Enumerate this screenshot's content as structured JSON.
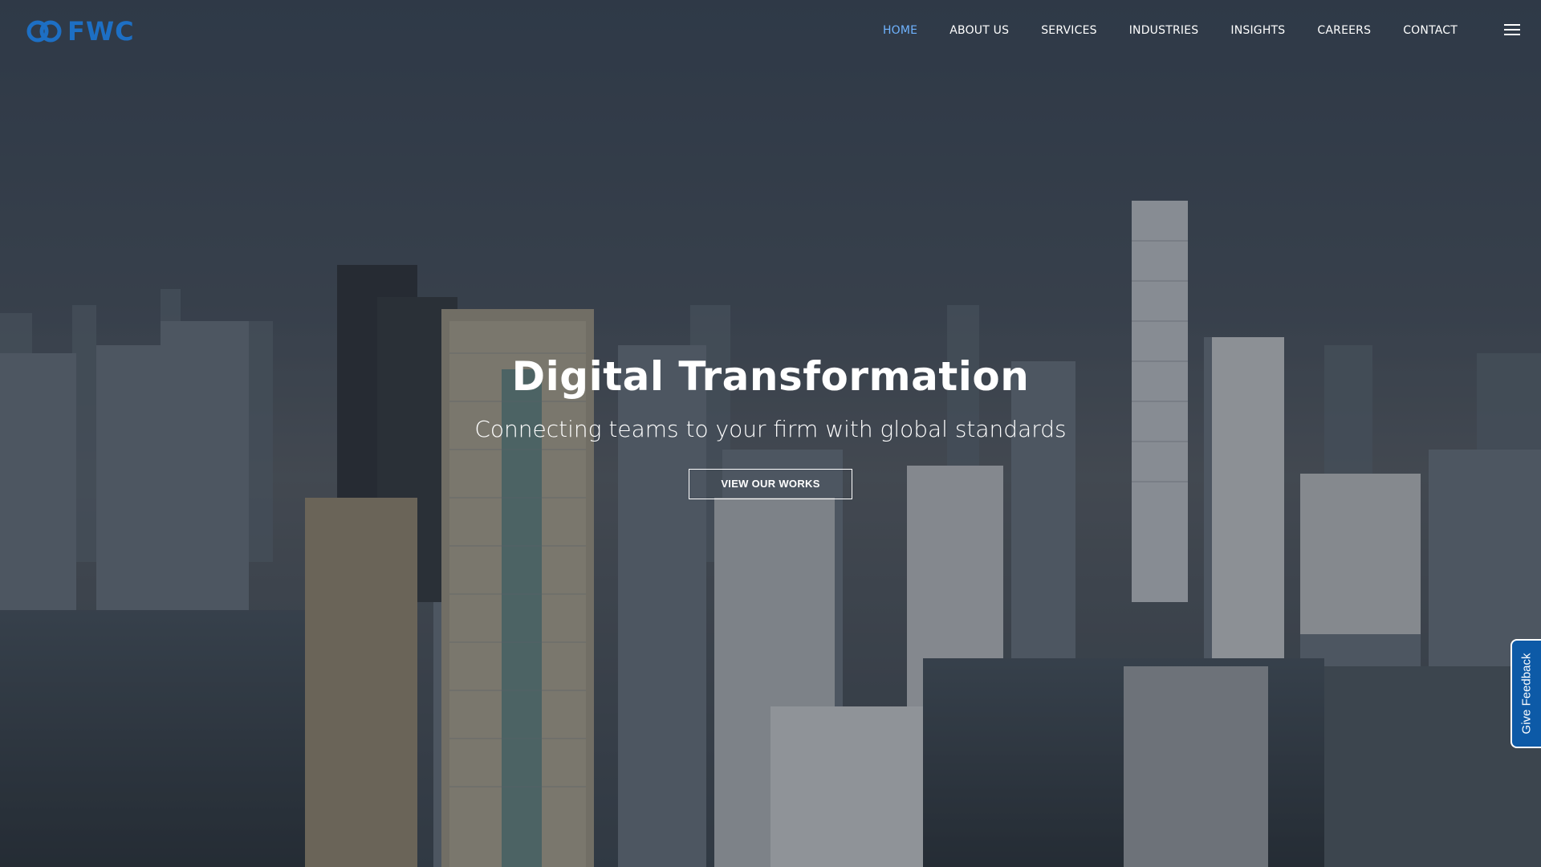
{
  "brand": {
    "logo_text": "FWC",
    "accent_color": "#1d6fc4"
  },
  "nav": {
    "items": [
      {
        "label": "HOME",
        "active": true
      },
      {
        "label": "ABOUT US",
        "active": false
      },
      {
        "label": "SERVICES",
        "active": false
      },
      {
        "label": "INDUSTRIES",
        "active": false
      },
      {
        "label": "INSIGHTS",
        "active": false
      },
      {
        "label": "CAREERS",
        "active": false
      },
      {
        "label": "CONTACT",
        "active": false
      }
    ],
    "active_color": "#6fb3ff",
    "menu_icon": "hamburger-menu-icon"
  },
  "hero": {
    "title": "Digital Transformation",
    "subtitle": "Connecting teams to your firm with global standards",
    "button_label": "VIEW OUR WORKS",
    "background": "city-skyline-photo"
  },
  "feedback": {
    "label": "Give Feedback",
    "color": "#0d5aa7"
  }
}
